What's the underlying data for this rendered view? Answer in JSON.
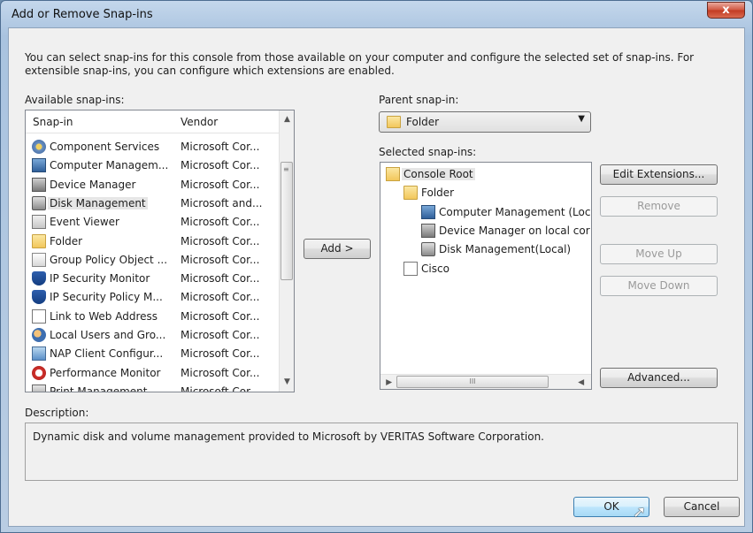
{
  "window": {
    "title": "Add or Remove Snap-ins",
    "close_label": "x"
  },
  "intro": "You can select snap-ins for this console from those available on your computer and configure the selected set of snap-ins. For extensible snap-ins, you can configure which extensions are enabled.",
  "available": {
    "label": "Available snap-ins:",
    "columns": {
      "snapin": "Snap-in",
      "vendor": "Vendor"
    },
    "items": [
      {
        "name": "Component Services",
        "vendor": "Microsoft Cor...",
        "icon": "component-services-icon"
      },
      {
        "name": "Computer Managem...",
        "vendor": "Microsoft Cor...",
        "icon": "computer-management-icon"
      },
      {
        "name": "Device Manager",
        "vendor": "Microsoft Cor...",
        "icon": "device-manager-icon"
      },
      {
        "name": "Disk Management",
        "vendor": "Microsoft and...",
        "icon": "disk-management-icon",
        "selected": true
      },
      {
        "name": "Event Viewer",
        "vendor": "Microsoft Cor...",
        "icon": "event-viewer-icon"
      },
      {
        "name": "Folder",
        "vendor": "Microsoft Cor...",
        "icon": "folder-icon"
      },
      {
        "name": "Group Policy Object ...",
        "vendor": "Microsoft Cor...",
        "icon": "group-policy-icon"
      },
      {
        "name": "IP Security Monitor",
        "vendor": "Microsoft Cor...",
        "icon": "ip-security-icon"
      },
      {
        "name": "IP Security Policy M...",
        "vendor": "Microsoft Cor...",
        "icon": "ip-security-policy-icon"
      },
      {
        "name": "Link to Web Address",
        "vendor": "Microsoft Cor...",
        "icon": "web-link-icon"
      },
      {
        "name": "Local Users and Gro...",
        "vendor": "Microsoft Cor...",
        "icon": "local-users-icon"
      },
      {
        "name": "NAP Client Configur...",
        "vendor": "Microsoft Cor...",
        "icon": "nap-client-icon"
      },
      {
        "name": "Performance Monitor",
        "vendor": "Microsoft Cor...",
        "icon": "performance-monitor-icon"
      },
      {
        "name": "Print Management",
        "vendor": "Microsoft Cor...",
        "icon": "print-management-icon"
      }
    ]
  },
  "add_button": "Add >",
  "parent": {
    "label": "Parent snap-in:",
    "value": "Folder"
  },
  "selected": {
    "label": "Selected snap-ins:",
    "tree": [
      {
        "text": "Console Root",
        "icon": "console-root-icon",
        "selected": true
      },
      {
        "text": "Folder",
        "icon": "folder-icon"
      },
      {
        "text": "Computer Management (Loc",
        "icon": "computer-management-icon"
      },
      {
        "text": "Device Manager on local cor",
        "icon": "device-manager-icon"
      },
      {
        "text": "Disk Management(Local)",
        "icon": "disk-management-icon"
      },
      {
        "text": "Cisco",
        "icon": "web-link-icon"
      }
    ],
    "hscroll_grip": "III"
  },
  "buttons": {
    "edit_extensions": "Edit Extensions...",
    "remove": "Remove",
    "move_up": "Move Up",
    "move_down": "Move Down",
    "advanced": "Advanced...",
    "ok": "OK",
    "cancel": "Cancel"
  },
  "description": {
    "label": "Description:",
    "text": "Dynamic disk and volume management provided to Microsoft by VERITAS Software Corporation."
  }
}
